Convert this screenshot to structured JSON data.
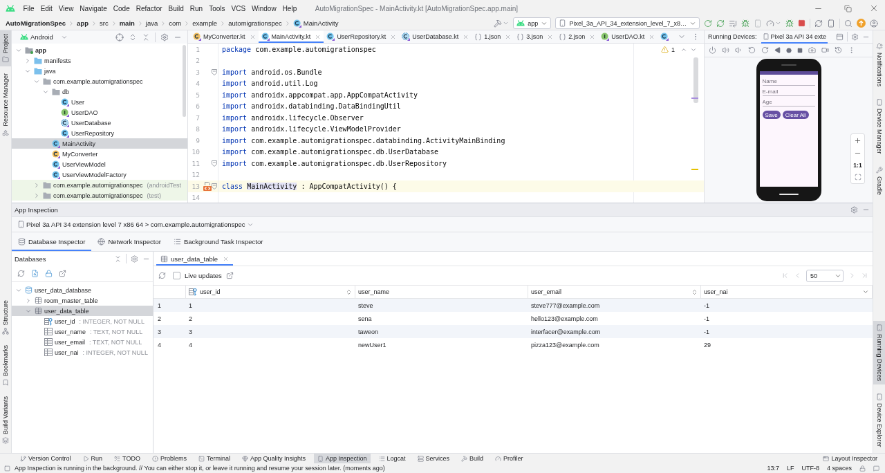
{
  "menu_bar": {
    "items": [
      "File",
      "Edit",
      "View",
      "Navigate",
      "Code",
      "Refactor",
      "Build",
      "Run",
      "Tools",
      "VCS",
      "Window",
      "Help"
    ],
    "window_title": "AutoMigrationSpec - MainActivity.kt [AutoMigrationSpec.app.main]"
  },
  "breadcrumbs": [
    {
      "label": "AutoMigrationSpec",
      "kind": "plain",
      "bold": true
    },
    {
      "label": "app",
      "kind": "plain",
      "bold": true
    },
    {
      "label": "src",
      "kind": "plain",
      "bold": false
    },
    {
      "label": "main",
      "kind": "plain",
      "bold": true
    },
    {
      "label": "java",
      "kind": "plain",
      "bold": false
    },
    {
      "label": "com",
      "kind": "plain",
      "bold": false
    },
    {
      "label": "example",
      "kind": "plain",
      "bold": false
    },
    {
      "label": "automigrationspec",
      "kind": "plain",
      "bold": false
    },
    {
      "label": "MainActivity",
      "kind": "class",
      "bold": false
    }
  ],
  "toolbar": {
    "run_config": "app",
    "device": "Pixel_3a_API_34_extension_level_7_x8…"
  },
  "left_strip": {
    "top": [
      {
        "label": "Project",
        "selected": true
      },
      {
        "label": "Resource Manager",
        "selected": false
      }
    ],
    "bottom": [
      {
        "label": "Structure",
        "selected": false
      },
      {
        "label": "Bookmarks",
        "selected": false
      },
      {
        "label": "Build Variants",
        "selected": false
      }
    ]
  },
  "project_panel": {
    "view": "Android",
    "tree": [
      {
        "label": "app",
        "kind": "module",
        "expanded": true,
        "selected": false,
        "children": [
          {
            "label": "manifests",
            "kind": "folder",
            "expanded": false,
            "selected": false
          },
          {
            "label": "java",
            "kind": "folder",
            "expanded": true,
            "selected": false,
            "children": [
              {
                "label": "com.example.automigrationspec",
                "kind": "package",
                "expanded": true,
                "selected": false,
                "children": [
                  {
                    "label": "db",
                    "kind": "package",
                    "expanded": true,
                    "selected": false,
                    "children": [
                      {
                        "label": "User",
                        "kind": "class",
                        "selected": false
                      },
                      {
                        "label": "UserDAO",
                        "kind": "interface",
                        "selected": false
                      },
                      {
                        "label": "UserDatabase",
                        "kind": "abstract_class",
                        "selected": false
                      },
                      {
                        "label": "UserRepository",
                        "kind": "class",
                        "selected": false
                      }
                    ]
                  },
                  {
                    "label": "MainActivity",
                    "kind": "class",
                    "selected": true
                  },
                  {
                    "label": "MyConverter",
                    "kind": "object",
                    "selected": false
                  },
                  {
                    "label": "UserViewModel",
                    "kind": "class",
                    "selected": false
                  },
                  {
                    "label": "UserViewModelFactory",
                    "kind": "class",
                    "selected": false
                  }
                ]
              },
              {
                "label": "com.example.automigrationspec",
                "suffix": "(androidTest",
                "kind": "test_package",
                "expanded": false,
                "selected": false
              },
              {
                "label": "com.example.automigrationspec",
                "suffix": "(test)",
                "kind": "test_package",
                "expanded": false,
                "selected": false
              }
            ]
          }
        ]
      }
    ]
  },
  "editor": {
    "tabs": [
      {
        "label": "MyConverter.kt",
        "kind": "object",
        "selected": false
      },
      {
        "label": "MainActivity.kt",
        "kind": "class",
        "selected": true
      },
      {
        "label": "UserRepository.kt",
        "kind": "class",
        "selected": false
      },
      {
        "label": "UserDatabase.kt",
        "kind": "abstract_class",
        "selected": false
      },
      {
        "label": "1.json",
        "kind": "json",
        "selected": false
      },
      {
        "label": "3.json",
        "kind": "json",
        "selected": false
      },
      {
        "label": "2.json",
        "kind": "json",
        "selected": false
      },
      {
        "label": "UserDAO.kt",
        "kind": "interface",
        "selected": false
      },
      {
        "kind": "class",
        "selected": false
      }
    ],
    "warning_count": "1",
    "lines": [
      {
        "number": "1",
        "tokens": [
          {
            "kind": "keyword",
            "text": "package"
          },
          {
            "kind": "plain",
            "text": "com.example.automigrationspec"
          }
        ],
        "fold": false,
        "current": false,
        "gutter_icon": false
      },
      {
        "number": "2",
        "fold": false,
        "current": false,
        "gutter_icon": false
      },
      {
        "number": "3",
        "tokens": [
          {
            "kind": "keyword",
            "text": "import"
          },
          {
            "kind": "plain",
            "text": "android.os.Bundle"
          }
        ],
        "fold": true,
        "current": false,
        "gutter_icon": false
      },
      {
        "number": "4",
        "tokens": [
          {
            "kind": "keyword",
            "text": "import"
          },
          {
            "kind": "plain",
            "text": "android.util.Log"
          }
        ],
        "fold": false,
        "current": false,
        "gutter_icon": false
      },
      {
        "number": "5",
        "tokens": [
          {
            "kind": "keyword",
            "text": "import"
          },
          {
            "kind": "plain",
            "text": "androidx.appcompat.app.AppCompatActivity"
          }
        ],
        "fold": false,
        "current": false,
        "gutter_icon": false
      },
      {
        "number": "6",
        "tokens": [
          {
            "kind": "keyword",
            "text": "import"
          },
          {
            "kind": "plain",
            "text": "androidx.databinding.DataBindingUtil"
          }
        ],
        "fold": false,
        "current": false,
        "gutter_icon": false
      },
      {
        "number": "7",
        "tokens": [
          {
            "kind": "keyword",
            "text": "import"
          },
          {
            "kind": "plain",
            "text": "androidx.lifecycle.Observer"
          }
        ],
        "fold": false,
        "current": false,
        "gutter_icon": false
      },
      {
        "number": "8",
        "tokens": [
          {
            "kind": "keyword",
            "text": "import"
          },
          {
            "kind": "plain",
            "text": "androidx.lifecycle.ViewModelProvider"
          }
        ],
        "fold": false,
        "current": false,
        "gutter_icon": false
      },
      {
        "number": "9",
        "tokens": [
          {
            "kind": "keyword",
            "text": "import"
          },
          {
            "kind": "plain",
            "text": "com.example.automigrationspec.databinding.ActivityMainBinding"
          }
        ],
        "fold": false,
        "current": false,
        "gutter_icon": false
      },
      {
        "number": "10",
        "tokens": [
          {
            "kind": "keyword",
            "text": "import"
          },
          {
            "kind": "plain",
            "text": "com.example.automigrationspec.db.UserDatabase"
          }
        ],
        "fold": false,
        "current": false,
        "gutter_icon": false
      },
      {
        "number": "11",
        "tokens": [
          {
            "kind": "keyword",
            "text": "import"
          },
          {
            "kind": "plain",
            "text": "com.example.automigrationspec.db.UserRepository"
          }
        ],
        "fold": true,
        "current": false,
        "gutter_icon": false
      },
      {
        "number": "12",
        "fold": false,
        "current": false,
        "gutter_icon": false
      },
      {
        "number": "13",
        "tokens": [
          {
            "kind": "keyword",
            "text": "class"
          },
          {
            "kind": "highlight",
            "text": "MainActivity"
          },
          {
            "kind": "plain",
            "text": ": AppCompatActivity() {"
          }
        ],
        "fold": true,
        "current": true,
        "gutter_icon": true
      },
      {
        "number": "14",
        "fold": false,
        "current": false,
        "gutter_icon": false
      }
    ]
  },
  "running_devices": {
    "title": "Running Devices:",
    "device_tabs": [
      {
        "label": "Pixel 3a API 34 exte",
        "selected": true
      }
    ],
    "screen": {
      "fields": [
        {
          "placeholder": "Name"
        },
        {
          "placeholder": "E-mail"
        },
        {
          "placeholder": "Age"
        }
      ],
      "buttons": [
        "Save",
        "Clear All"
      ]
    },
    "zoom_reset": "1:1"
  },
  "right_strip": {
    "top": [
      {
        "label": "Notifications",
        "selected": false
      },
      {
        "label": "Device Manager",
        "selected": false
      },
      {
        "label": "Gradle",
        "selected": false
      }
    ],
    "bottom": [
      {
        "label": "Running Devices",
        "selected": true
      },
      {
        "label": "Device Explorer",
        "selected": false
      }
    ]
  },
  "app_inspection": {
    "title": "App Inspection",
    "process": "Pixel 3a API 34 extension level 7 x86 64 > com.example.automigrationspec",
    "tabs": [
      {
        "label": "Database Inspector",
        "kind": "database",
        "selected": true
      },
      {
        "label": "Network Inspector",
        "kind": "network",
        "selected": false
      },
      {
        "label": "Background Task Inspector",
        "kind": "tasks",
        "selected": false
      }
    ],
    "databases": {
      "title": "Databases",
      "tree": [
        {
          "label": "user_data_database",
          "kind": "database",
          "expanded": true,
          "selected": false,
          "children": [
            {
              "label": "room_master_table",
              "kind": "table",
              "expanded": false,
              "selected": false
            },
            {
              "label": "user_data_table",
              "kind": "table",
              "expanded": true,
              "selected": true,
              "children": [
                {
                  "label": "user_id",
                  "type": ": INTEGER, NOT NULL",
                  "kind": "primary_key",
                  "selected": false
                },
                {
                  "label": "user_name",
                  "type": ": TEXT, NOT NULL",
                  "kind": "column",
                  "selected": false
                },
                {
                  "label": "user_email",
                  "type": ": TEXT, NOT NULL",
                  "kind": "column",
                  "selected": false
                },
                {
                  "label": "user_nai",
                  "type": ": INTEGER, NOT NULL",
                  "kind": "column",
                  "selected": false
                }
              ]
            }
          ]
        }
      ]
    },
    "table_view": {
      "tab": "user_data_table",
      "live_updates": {
        "label": "Live updates",
        "checked": false
      },
      "page_size": "50",
      "columns": [
        {
          "name": "user_id",
          "kind": "primary_key",
          "sort_icon": true
        },
        {
          "name": "user_name",
          "kind": "column",
          "sort_icon": false
        },
        {
          "name": "user_email",
          "kind": "column",
          "sort_icon": true
        },
        {
          "name": "user_nai",
          "kind": "column",
          "sort_icon": false
        }
      ],
      "rows": [
        {
          "number": "1",
          "cells": [
            "1",
            "steve",
            "steve777@example.com",
            "-1"
          ]
        },
        {
          "number": "2",
          "cells": [
            "2",
            "sena",
            "hello123@example.com",
            "-1"
          ]
        },
        {
          "number": "3",
          "cells": [
            "3",
            "taweon",
            "interfacer@example.com",
            "-1"
          ]
        },
        {
          "number": "4",
          "cells": [
            "4",
            "newUser1",
            "pizza123@example.com",
            "29"
          ]
        }
      ]
    }
  },
  "tool_strip": {
    "items": [
      {
        "label": "Version Control",
        "selected": false
      },
      {
        "label": "Run",
        "selected": false
      },
      {
        "label": "TODO",
        "selected": false
      },
      {
        "label": "Problems",
        "selected": false
      },
      {
        "label": "Terminal",
        "selected": false
      },
      {
        "label": "App Quality Insights",
        "selected": false
      },
      {
        "label": "App Inspection",
        "selected": true
      },
      {
        "label": "Logcat",
        "selected": false
      },
      {
        "label": "Services",
        "selected": false
      },
      {
        "label": "Build",
        "selected": false
      },
      {
        "label": "Profiler",
        "selected": false
      }
    ],
    "right": "Layout Inspector"
  },
  "status_bar": {
    "message": "App Inspection is running in the background. // You can either stop it, or leave it running and resume your session later. (moments ago)",
    "items": [
      "13:7",
      "LF",
      "UTF-8",
      "4 spaces"
    ]
  }
}
